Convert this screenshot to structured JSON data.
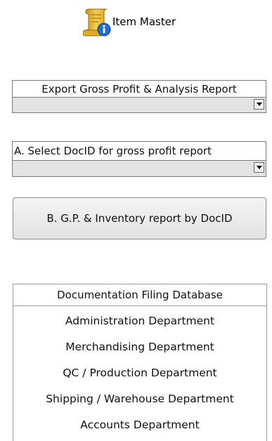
{
  "header": {
    "title": "Item Master",
    "icon": "scroll-info-icon"
  },
  "export_combo": {
    "label": "Export Gross Profit & Analysis Report",
    "value": ""
  },
  "docid_combo": {
    "label": "A. Select DocID for gross profit report",
    "value": ""
  },
  "gp_button": {
    "label": "B. G.P. & Inventory report by DocID"
  },
  "doc_panel": {
    "title": "Documentation Filing Database",
    "items": [
      "Administration Department",
      "Merchandising Department",
      "QC / Production Department",
      "Shipping / Warehouse Department",
      "Accounts Department"
    ]
  },
  "colors": {
    "field_bg": "#e3e3e3",
    "scroll": "#e8b830",
    "info_blue": "#1f6fd0"
  }
}
